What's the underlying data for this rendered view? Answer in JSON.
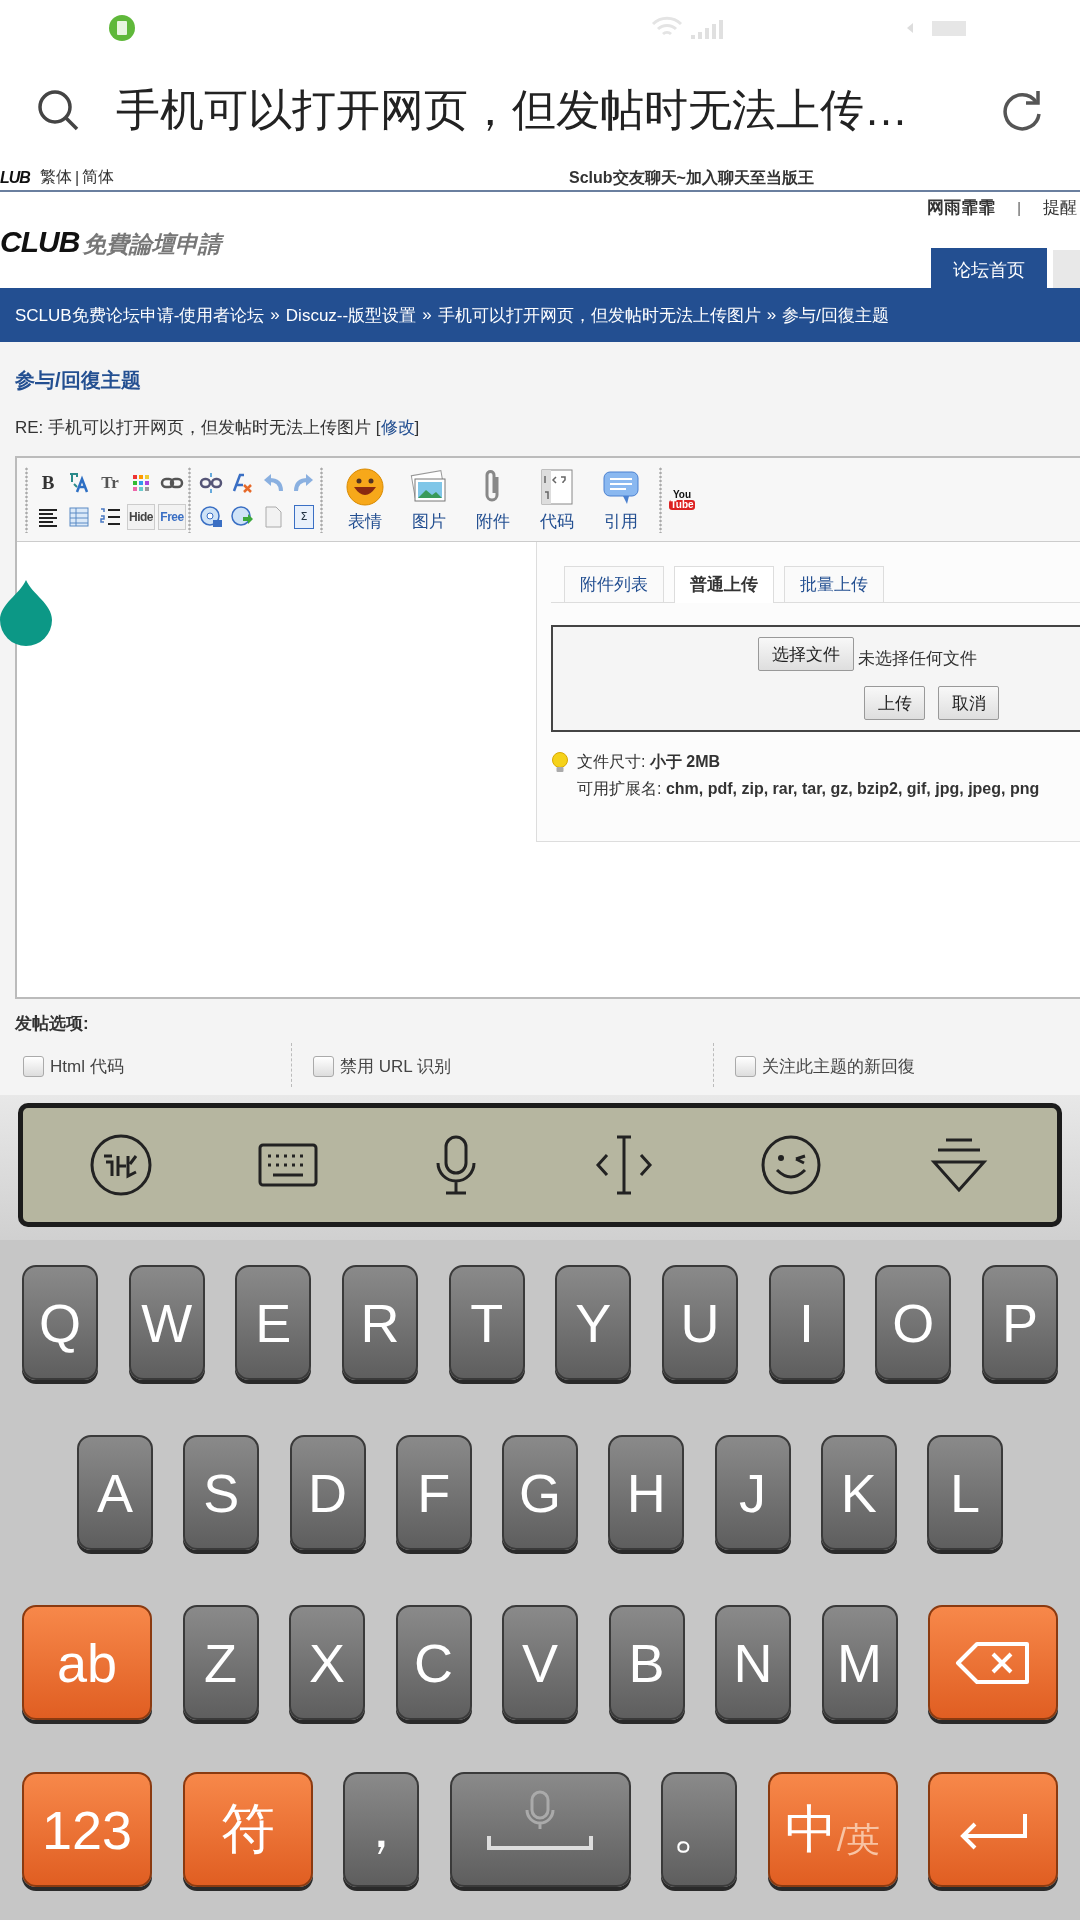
{
  "address_bar": {
    "title": "手机可以打开网页，但发帖时无法上传…"
  },
  "forum": {
    "top_strip": {
      "logo_text": "LUB",
      "lang_links": [
        "繁体",
        "简体"
      ],
      "lang_separator": "|",
      "promo_link": "Sclub交友聊天~加入聊天至当版王"
    },
    "header": {
      "logo_text": "CLUB",
      "logo_tagline": "免費論壇申請",
      "user": "网雨霏霏",
      "user_separator": "|",
      "user_links": [
        "提醒"
      ],
      "nav_tabs": [
        {
          "label": "论坛首页",
          "selected": true
        }
      ]
    },
    "breadcrumb": {
      "separator": "»",
      "items": [
        "SCLUB免费论坛申请-使用者论坛",
        "Discuz--版型设置",
        "手机可以打开网页，但发帖时无法上传图片",
        "参与/回復主题"
      ]
    },
    "page_title": "参与/回復主题",
    "subject": {
      "text": "RE: 手机可以打开网页，但发帖时无法上传图片 [",
      "edit_link": "修改",
      "suffix": "]"
    },
    "toolbar": [
      {
        "kind": "small",
        "rows": [
          [
            {
              "kind": "bold",
              "text": "B"
            },
            {
              "kind": "font"
            },
            {
              "kind": "size",
              "text": "Tr"
            },
            {
              "kind": "color"
            },
            {
              "kind": "link"
            }
          ],
          [
            {
              "kind": "align"
            },
            {
              "kind": "table"
            },
            {
              "kind": "list"
            },
            {
              "kind": "tagbox",
              "text": "Hide"
            },
            {
              "kind": "tagbox",
              "text": "Free"
            }
          ]
        ]
      },
      {
        "kind": "small",
        "rows": [
          [
            {
              "kind": "unlink"
            },
            {
              "kind": "clear"
            },
            {
              "kind": "undo"
            },
            {
              "kind": "redo"
            }
          ],
          [
            {
              "kind": "media"
            },
            {
              "kind": "flash"
            },
            {
              "kind": "page"
            },
            {
              "kind": "formula",
              "text": "Σ"
            }
          ]
        ]
      },
      {
        "kind": "large",
        "buttons": [
          {
            "kind": "smile",
            "label": "表情"
          },
          {
            "kind": "image",
            "label": "图片"
          },
          {
            "kind": "attach",
            "label": "附件"
          },
          {
            "kind": "code",
            "label": "代码"
          },
          {
            "kind": "quote",
            "label": "引用"
          }
        ]
      },
      {
        "kind": "small",
        "rows": [
          [
            {
              "kind": "youtube",
              "text": "You",
              "text2": "Tube"
            }
          ]
        ]
      }
    ],
    "upload_panel": {
      "tabs": [
        {
          "label": "附件列表",
          "selected": false
        },
        {
          "label": "普通上传",
          "selected": true
        },
        {
          "label": "批量上传",
          "selected": false
        }
      ],
      "choose_button": "选择文件",
      "no_file": "未选择任何文件",
      "upload_button": "上传",
      "cancel_button": "取消",
      "size_label": "文件尺寸: ",
      "size_value": "小于 2MB",
      "ext_label": "可用扩展名: ",
      "ext_value": "chm, pdf, zip, rar, tar, gz, bzip2, gif, jpg, jpeg, png"
    },
    "post_options": {
      "title": "发帖选项:",
      "options": [
        {
          "label": "Html 代码",
          "checked": false
        },
        {
          "label": "禁用 URL 识别",
          "checked": false
        },
        {
          "label": "关注此主题的新回復",
          "checked": false
        }
      ]
    }
  },
  "keyboard": {
    "tools": [
      {
        "kind": "logo"
      },
      {
        "kind": "keyboard"
      },
      {
        "kind": "mic"
      },
      {
        "kind": "cursor"
      },
      {
        "kind": "emoji"
      },
      {
        "kind": "hide"
      }
    ],
    "rows": [
      {
        "keys": [
          {
            "kind": "letter",
            "label": "Q"
          },
          {
            "kind": "letter",
            "label": "W"
          },
          {
            "kind": "letter",
            "label": "E"
          },
          {
            "kind": "letter",
            "label": "R"
          },
          {
            "kind": "letter",
            "label": "T"
          },
          {
            "kind": "letter",
            "label": "Y"
          },
          {
            "kind": "letter",
            "label": "U"
          },
          {
            "kind": "letter",
            "label": "I"
          },
          {
            "kind": "letter",
            "label": "O"
          },
          {
            "kind": "letter",
            "label": "P"
          }
        ]
      },
      {
        "keys": [
          {
            "kind": "letter",
            "label": "A"
          },
          {
            "kind": "letter",
            "label": "S"
          },
          {
            "kind": "letter",
            "label": "D"
          },
          {
            "kind": "letter",
            "label": "F"
          },
          {
            "kind": "letter",
            "label": "G"
          },
          {
            "kind": "letter",
            "label": "H"
          },
          {
            "kind": "letter",
            "label": "J"
          },
          {
            "kind": "letter",
            "label": "K"
          },
          {
            "kind": "letter",
            "label": "L"
          }
        ]
      },
      {
        "keys": [
          {
            "kind": "func",
            "label": "ab"
          },
          {
            "kind": "letter",
            "label": "Z"
          },
          {
            "kind": "letter",
            "label": "X"
          },
          {
            "kind": "letter",
            "label": "C"
          },
          {
            "kind": "letter",
            "label": "V"
          },
          {
            "kind": "letter",
            "label": "B"
          },
          {
            "kind": "letter",
            "label": "N"
          },
          {
            "kind": "letter",
            "label": "M"
          },
          {
            "kind": "backspace"
          }
        ]
      },
      {
        "keys": [
          {
            "kind": "func",
            "label": "123"
          },
          {
            "kind": "func",
            "label": "符"
          },
          {
            "kind": "letter",
            "label": "，"
          },
          {
            "kind": "space"
          },
          {
            "kind": "letter",
            "label": "。"
          },
          {
            "kind": "lang",
            "label": "中",
            "sub": "/英"
          },
          {
            "kind": "enter"
          }
        ]
      }
    ]
  }
}
